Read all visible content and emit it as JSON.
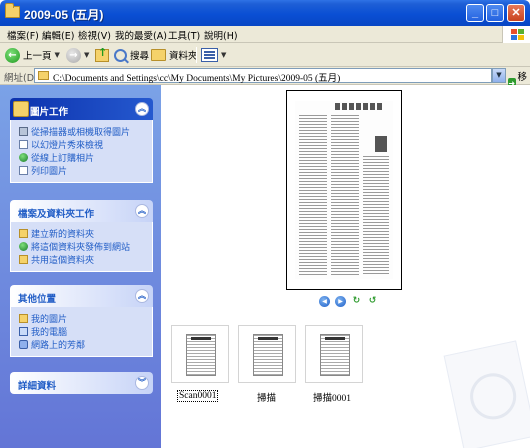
{
  "window": {
    "title": "2009-05 (五月)"
  },
  "menu": [
    "檔案(F)",
    "編輯(E)",
    "檢視(V)",
    "我的最愛(A)",
    "工具(T)",
    "說明(H)"
  ],
  "toolbar": {
    "back_label": "上一頁",
    "search_label": "搜尋",
    "folders_label": "資料夾"
  },
  "address": {
    "label": "網址(D)",
    "path": "C:\\Documents and Settings\\cc\\My Documents\\My Pictures\\2009-05 (五月)",
    "go_label": "移至"
  },
  "tasks": {
    "picture": {
      "title": "圖片工作",
      "items": [
        "從掃描器或相機取得圖片",
        "以幻燈片秀來檢視",
        "從線上訂購相片",
        "列印圖片"
      ]
    },
    "file": {
      "title": "檔案及資料夾工作",
      "items": [
        "建立新的資料夾",
        "將這個資料夾發佈到網站",
        "共用這個資料夾"
      ]
    },
    "other": {
      "title": "其他位置",
      "items": [
        "我的圖片",
        "我的電腦",
        "網路上的芳鄰"
      ]
    },
    "details": {
      "title": "詳細資料"
    }
  },
  "files": [
    {
      "name": "Scan0001",
      "selected": true
    },
    {
      "name": "掃描",
      "selected": false
    },
    {
      "name": "掃描0001",
      "selected": false
    }
  ],
  "icons": [
    "folder-icon",
    "back-icon",
    "forward-icon",
    "up-folder-icon",
    "search-icon",
    "folders-icon",
    "views-icon",
    "chevron-up-icon",
    "chevron-down-icon"
  ]
}
